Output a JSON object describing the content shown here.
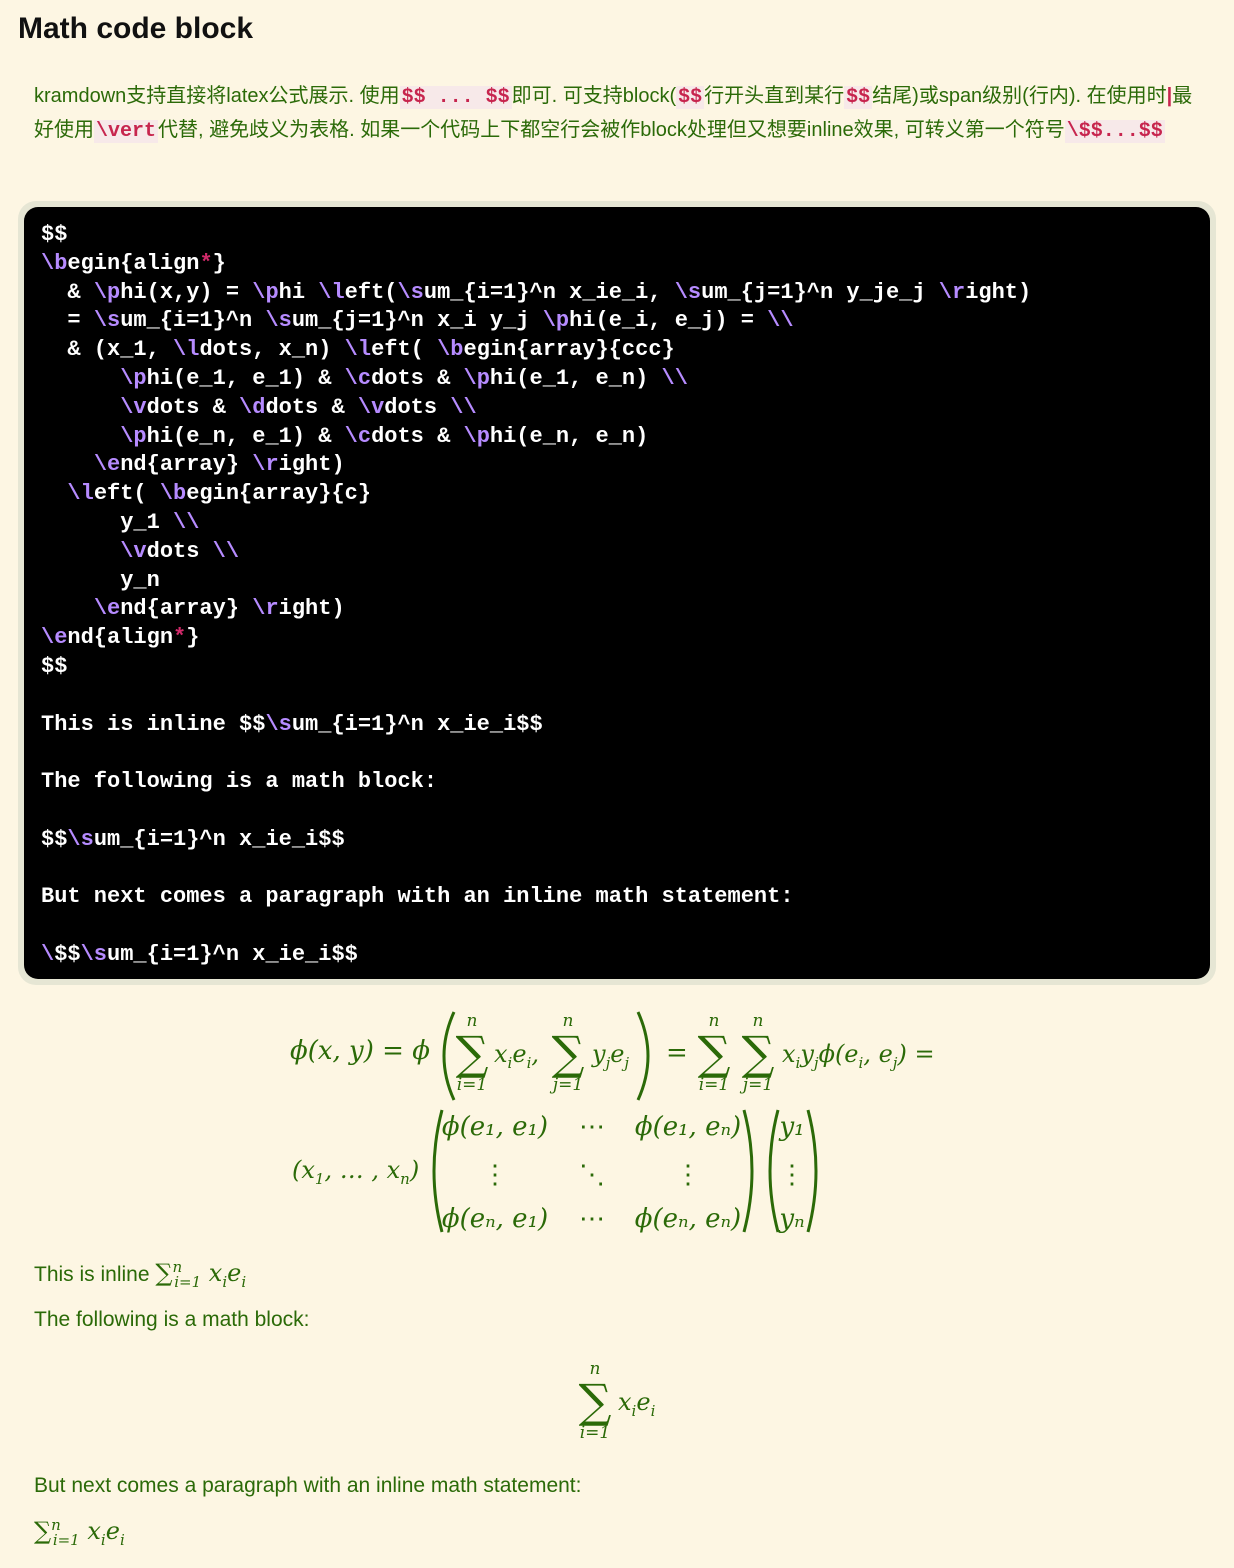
{
  "title": "Math code block",
  "intro": {
    "p1": "kramdown支持直接将latex公式展示. 使用",
    "c1": "$$ ... $$",
    "p2": "即可. 可支持block(",
    "c2": "$$",
    "p3": "行开头直到某行",
    "c3": "$$",
    "p4": "结尾)或span级别(行内). 在使用时",
    "pipe": "|",
    "p5": "最好使用",
    "c4": "\\vert",
    "p6": "代替, 避免歧义为表格. 如果一个代码上下都空行会被作block处理但又想要inline效果, 可转义第一个符号",
    "c5": "\\$$...$$"
  },
  "code_lines": [
    "$$",
    "\\begin{align*}",
    "  & \\phi(x,y) = \\phi \\left(\\sum_{i=1}^n x_ie_i, \\sum_{j=1}^n y_je_j \\right)",
    "  = \\sum_{i=1}^n \\sum_{j=1}^n x_i y_j \\phi(e_i, e_j) = \\\\",
    "  & (x_1, \\ldots, x_n) \\left( \\begin{array}{ccc}",
    "      \\phi(e_1, e_1) & \\cdots & \\phi(e_1, e_n) \\\\",
    "      \\vdots & \\ddots & \\vdots \\\\",
    "      \\phi(e_n, e_1) & \\cdots & \\phi(e_n, e_n)",
    "    \\end{array} \\right)",
    "  \\left( \\begin{array}{c}",
    "      y_1 \\\\",
    "      \\vdots \\\\",
    "      y_n",
    "    \\end{array} \\right)",
    "\\end{align*}",
    "$$",
    "",
    "This is inline $$\\sum_{i=1}^n x_ie_i$$",
    "",
    "The following is a math block:",
    "",
    "$$\\sum_{i=1}^n x_ie_i$$",
    "",
    "But next comes a paragraph with an inline math statement:",
    "",
    "\\$$\\sum_{i=1}^n x_ie_i$$"
  ],
  "rendered": {
    "eq_lhs": "ϕ(x, y) = ϕ",
    "sum_sym": "∑",
    "lim_top": "n",
    "lim_i": "i=1",
    "lim_j": "j=1",
    "term_xe": "x",
    "term_xe_sub": "i",
    "term_xe2": "e",
    "term_xe2_sub": "i",
    "comma": ",",
    "term_ye": "y",
    "term_ye_sub": "j",
    "term_ye2": "e",
    "term_ye2_sub": "j",
    "eq_mid": "=",
    "eq_tail": "x",
    "eq_tail_parts": [
      "i",
      "y",
      "j",
      "ϕ(e",
      "i",
      ", e",
      "j",
      ") ="
    ],
    "row2_lhs": "(x",
    "row2_lhs_sub1": "1",
    "row2_lhs_mid": ", … , x",
    "row2_lhs_subn": "n",
    "row2_lhs_close": ")",
    "matrix": [
      [
        "ϕ(e₁, e₁)",
        "⋯",
        "ϕ(e₁, eₙ)"
      ],
      [
        "⋮",
        "⋱",
        "⋮"
      ],
      [
        "ϕ(eₙ, e₁)",
        "⋯",
        "ϕ(eₙ, eₙ)"
      ]
    ],
    "vector": [
      "y₁",
      "⋮",
      "yₙ"
    ],
    "inline_label": "This is inline",
    "inline_math": "∑",
    "inline_math_sup": "n",
    "inline_math_sub": "i=1",
    "inline_math_term": "x",
    "inline_math_term_sub": "i",
    "inline_math_term2": "e",
    "inline_math_term2_sub": "i",
    "block_label": "The following is a math block:",
    "para_label": "But next comes a paragraph with an inline math statement:"
  },
  "colors": {
    "background": "#fdf6e3",
    "text": "#2b6a08",
    "code_bg": "#000000",
    "code_keyword": "#b68bff",
    "code_star": "#d12a6a",
    "inline_code": "#c7254e"
  }
}
